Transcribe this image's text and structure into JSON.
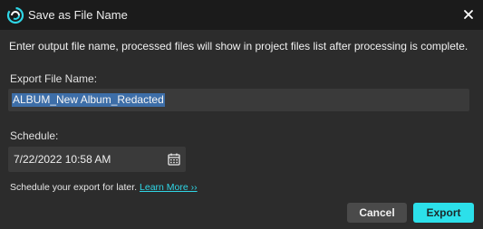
{
  "window": {
    "title": "Save as File Name",
    "logo_icon": "swirl-logo-icon",
    "close_icon": "close-icon"
  },
  "description": "Enter output file name, processed files will show in project files list after processing is complete.",
  "export_name": {
    "label": "Export File Name:",
    "value": "ALBUM_New Album_Redacted"
  },
  "schedule": {
    "label": "Schedule:",
    "value": "7/22/2022 10:58 AM",
    "icon": "calendar-icon",
    "hint_text": "Schedule your export for later.",
    "learn_more": "Learn More ››"
  },
  "buttons": {
    "cancel": "Cancel",
    "export": "Export"
  },
  "colors": {
    "accent": "#2ce0ea",
    "link": "#2fd6e6",
    "background": "#2c2c2c",
    "titlebar": "#1b1b1b",
    "selection": "#3d6ea8"
  }
}
